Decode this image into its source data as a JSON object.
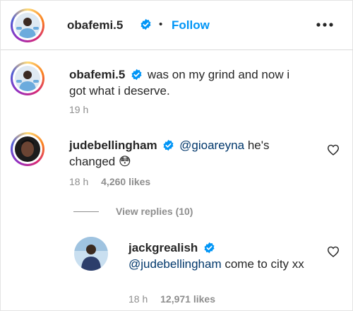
{
  "header": {
    "username": "obafemi.5",
    "separator": "•",
    "follow_label": "Follow",
    "more_icon": "more-horizontal-icon"
  },
  "caption": {
    "username": "obafemi.5",
    "text": "was on my grind and now i got what i deserve.",
    "time": "19 h"
  },
  "comments": [
    {
      "username": "judebellingham",
      "mention": "@gioareyna",
      "text": " he's changed",
      "emoji": "😳",
      "time": "18 h",
      "likes": "4,260 likes",
      "view_replies": "View replies (10)"
    }
  ],
  "reply": {
    "username": "jackgrealish",
    "mention": "@judebellingham",
    "text": " come to city xx",
    "time": "18 h",
    "likes": "12,971 likes"
  },
  "colors": {
    "verified": "#0095f6",
    "follow": "#0095f6",
    "mention": "#00376b",
    "meta": "#8e8e8e"
  }
}
